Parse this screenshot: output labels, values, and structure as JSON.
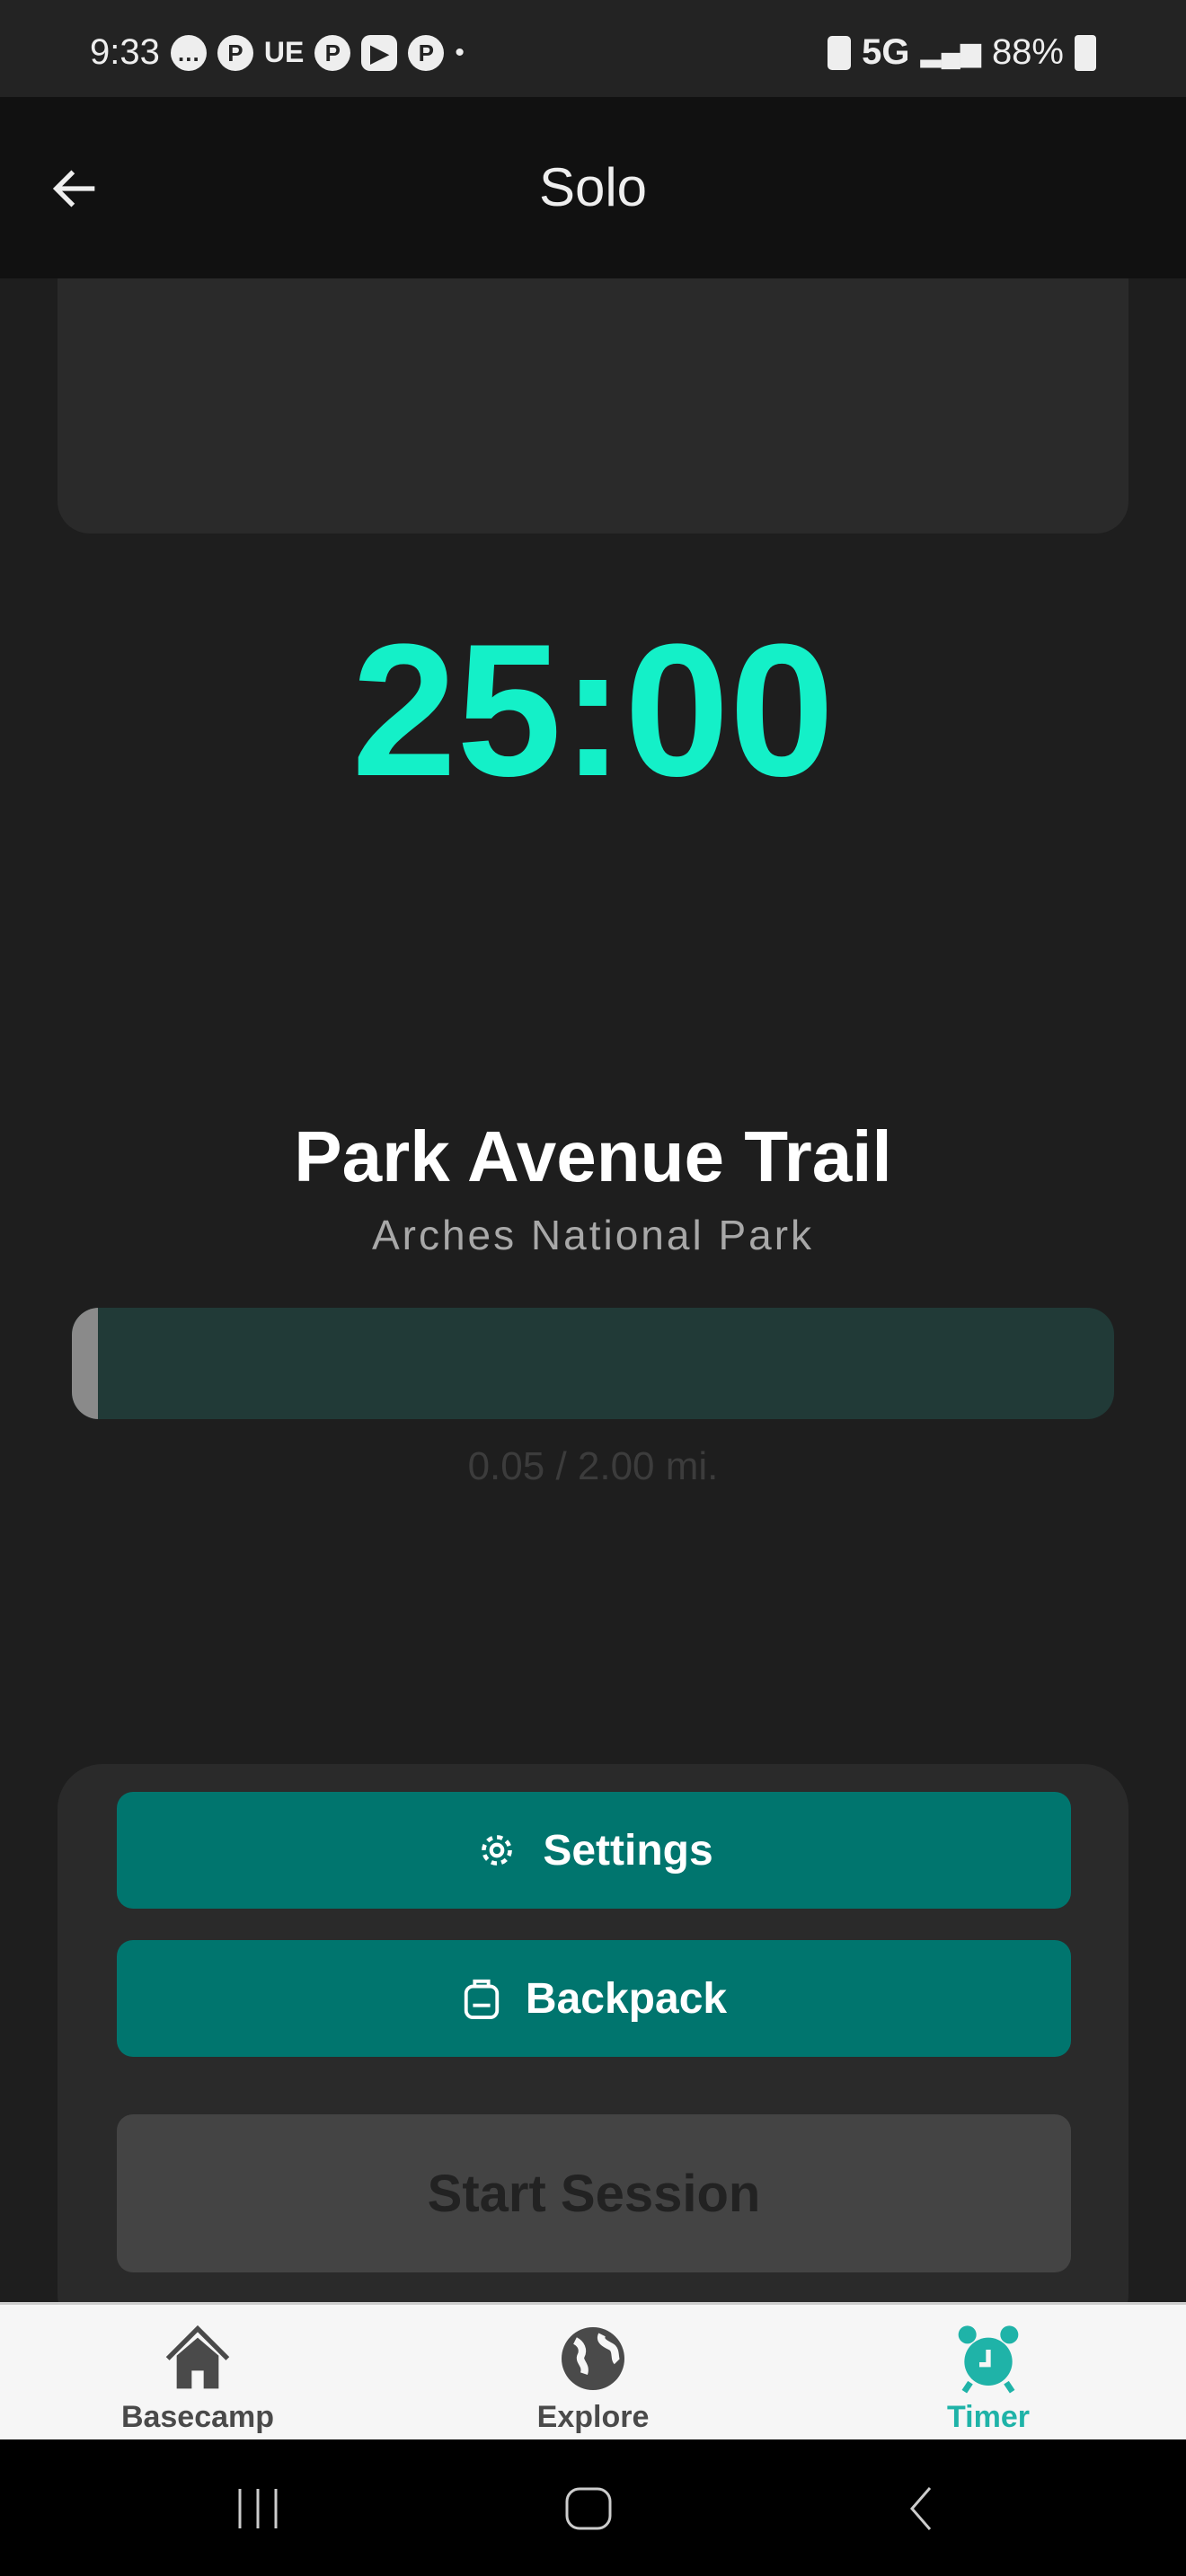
{
  "status_bar": {
    "time": "9:33",
    "notification_text": "UE",
    "network": "5G",
    "battery": "88%"
  },
  "header": {
    "title": "Solo"
  },
  "timer": {
    "display": "25:00"
  },
  "trail": {
    "name": "Park Avenue Trail",
    "park": "Arches National Park",
    "progress_fraction": 0.025,
    "distance": "0.05 / 2.00 mi."
  },
  "actions": {
    "settings": "Settings",
    "backpack": "Backpack",
    "start": "Start Session"
  },
  "colors": {
    "accent": "#14f0c8",
    "button": "#00756e",
    "active_tab": "#1fb3a8"
  },
  "tabs": [
    {
      "label": "Basecamp"
    },
    {
      "label": "Explore"
    },
    {
      "label": "Timer"
    }
  ]
}
